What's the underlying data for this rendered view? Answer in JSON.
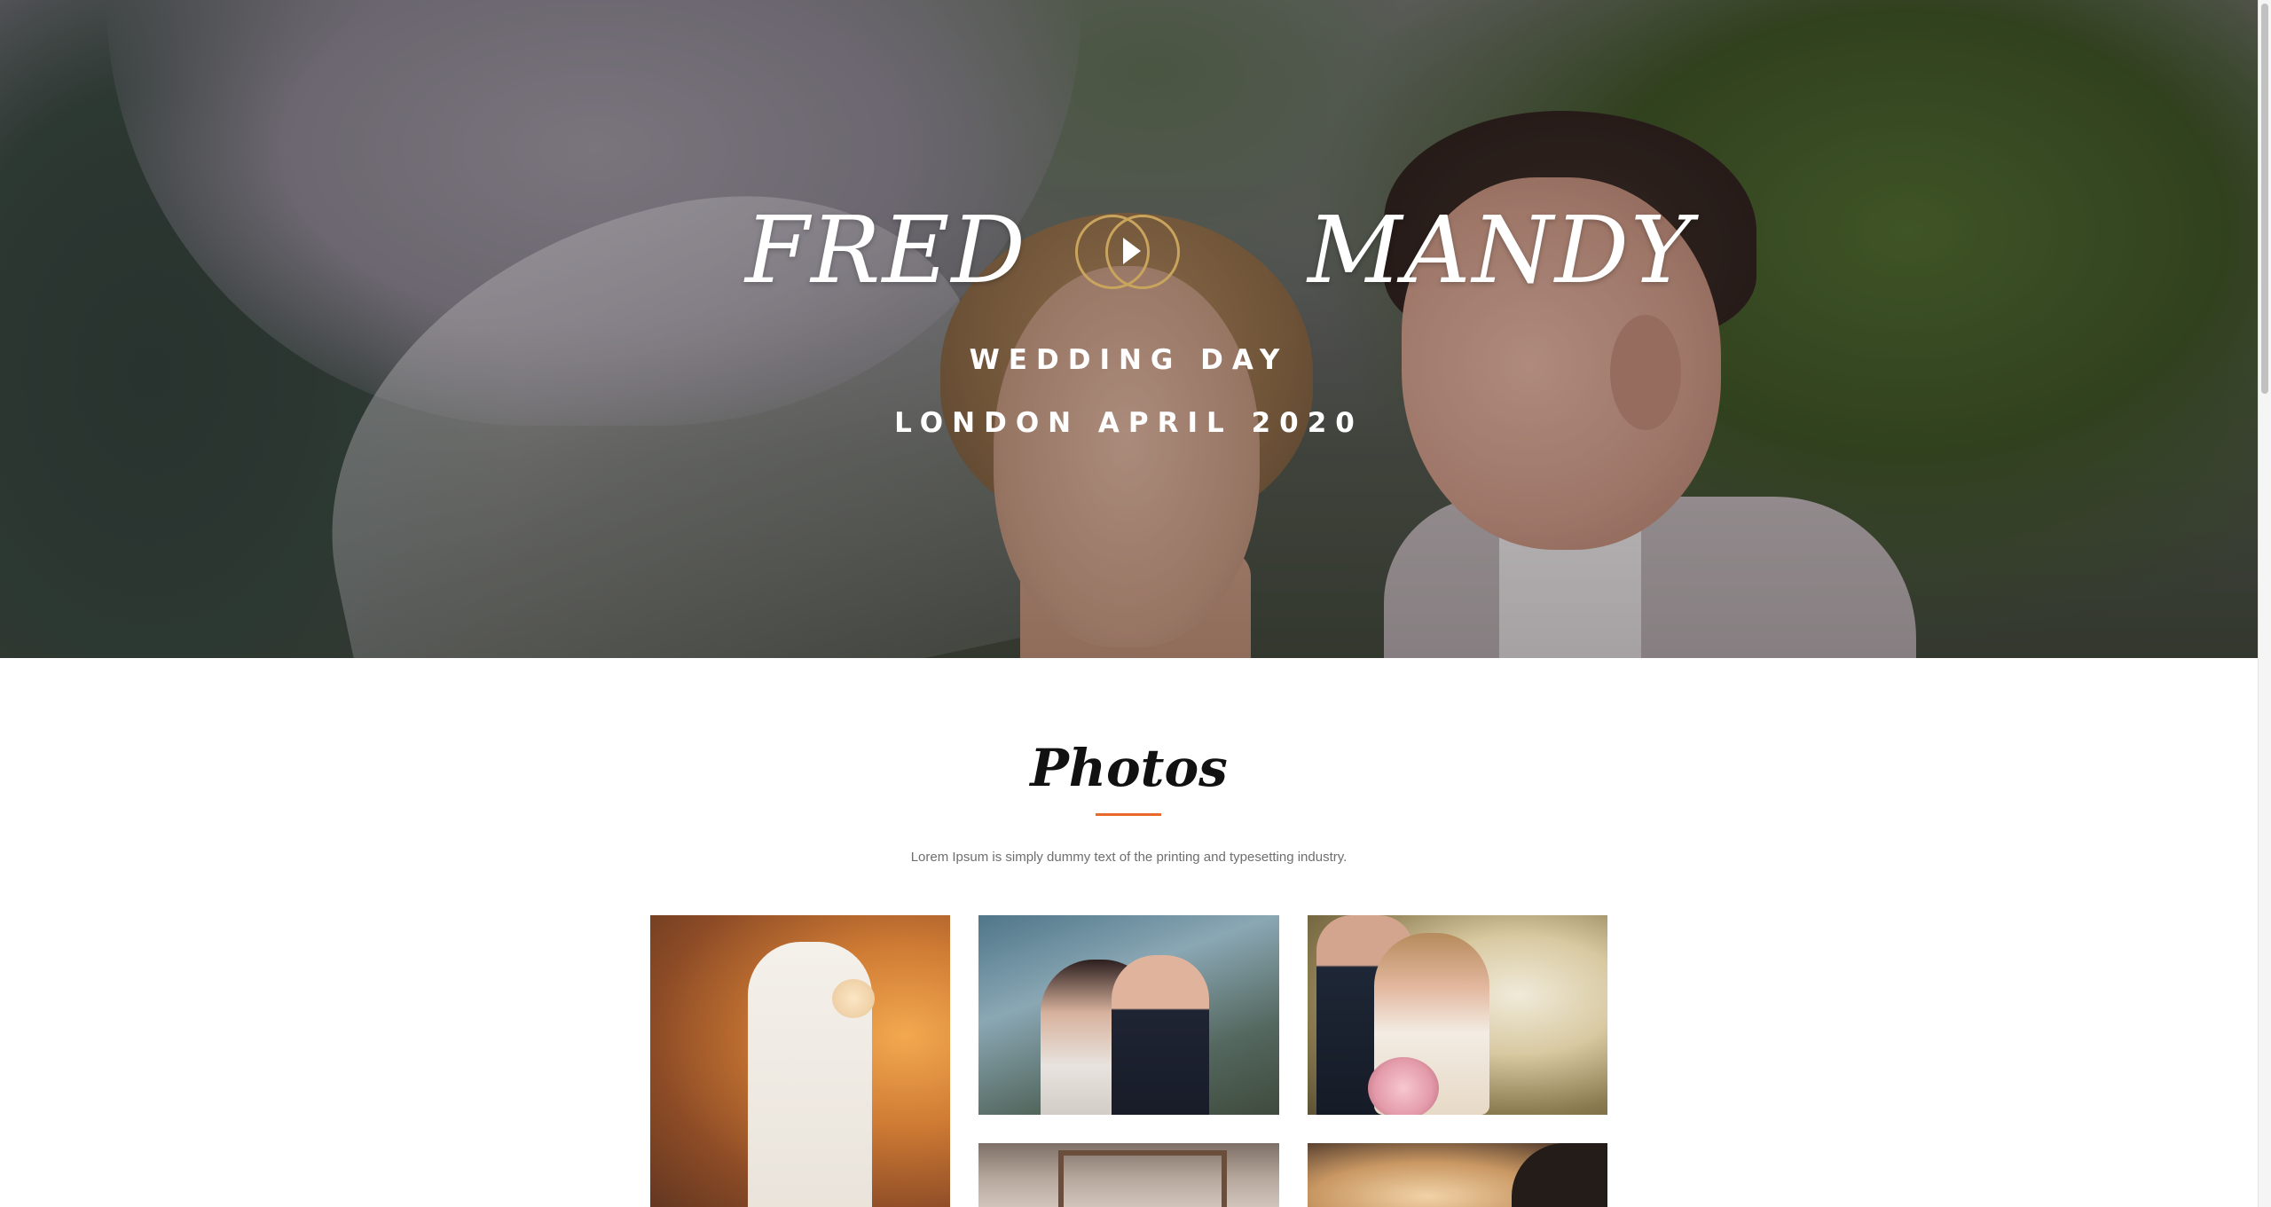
{
  "hero": {
    "name_left": "FRED",
    "name_right": "MANDY",
    "subtitle_1": "WEDDING DAY",
    "subtitle_2": "LONDON APRIL 2020",
    "play_icon": "play-rings-icon"
  },
  "photos_section": {
    "title": "Photos",
    "description": "Lorem Ipsum is simply dummy text of the printing and typesetting industry.",
    "photos": [
      {
        "subject": "bride-portrait"
      },
      {
        "subject": "couple-by-river"
      },
      {
        "subject": "couple-in-forest"
      },
      {
        "subject": "wedding-arch"
      },
      {
        "subject": "bokeh-lights"
      }
    ]
  },
  "colors": {
    "accent": "#e8692a",
    "ring_gold": "#c9a45c",
    "text_dark": "#111111",
    "text_muted": "#6e6e6e"
  }
}
